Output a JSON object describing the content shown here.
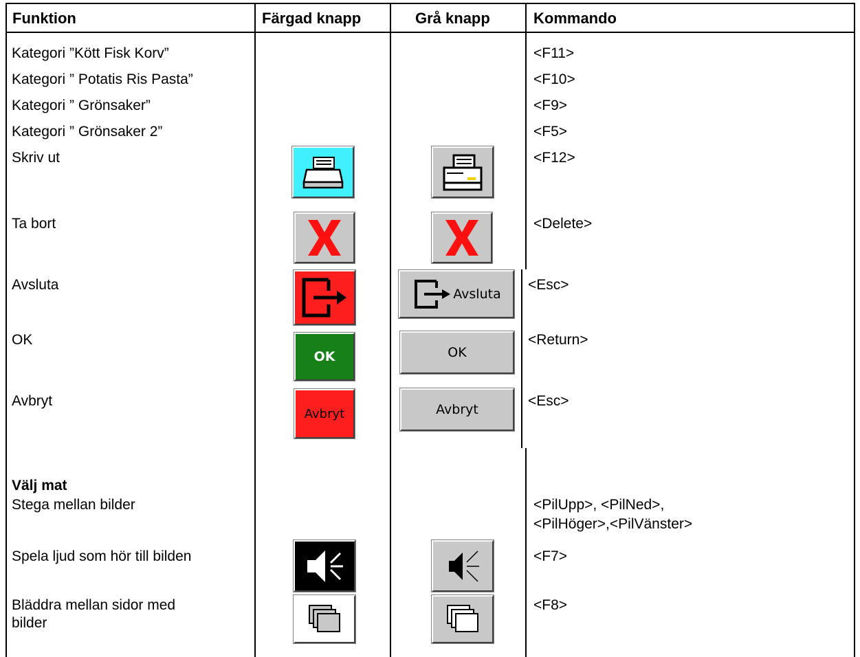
{
  "headers": {
    "function": "Funktion",
    "colored": "Färgad knapp",
    "gray": "Grå knapp",
    "command": "Kommando"
  },
  "rows": [
    {
      "function": "Kategori ”Kött Fisk Korv”",
      "command": "<F11>"
    },
    {
      "function": "Kategori ” Potatis Ris Pasta”",
      "command": "<F10>"
    },
    {
      "function": "Kategori ” Grönsaker”",
      "command": "<F9>"
    },
    {
      "function": "Kategori ” Grönsaker 2”",
      "command": "<F5>"
    },
    {
      "function": "Skriv ut",
      "command": "<F12>",
      "icon": "printer-icon"
    },
    {
      "function": "Ta bort",
      "command": "<Delete>",
      "icon": "delete-x-icon"
    },
    {
      "function": "Avsluta",
      "command": "<Esc>",
      "icon": "exit-door-icon",
      "gray_label": "Avsluta"
    },
    {
      "function": "OK",
      "command": "<Return>",
      "colored_label": "OK",
      "gray_label": "OK"
    },
    {
      "function": "Avbryt",
      "command": "<Esc>",
      "colored_label": "Avbryt",
      "gray_label": "Avbryt"
    },
    {
      "function": "Välj mat",
      "section": true
    },
    {
      "function": "Stega mellan bilder",
      "command": "<PilUpp>, <PilNed>,",
      "command2": "<PilHöger>,<PilVänster>"
    },
    {
      "function": "Spela ljud som hör till bilden",
      "command": "<F7>",
      "icon": "speaker-icon"
    },
    {
      "function": "Bläddra mellan sidor med",
      "function2": "bilder",
      "command": "<F8>",
      "icon": "pages-icon"
    }
  ],
  "colors": {
    "cyan": "#40f0ff",
    "red": "#ff1e1e",
    "green": "#188018",
    "gray": "#c8c8c8"
  }
}
